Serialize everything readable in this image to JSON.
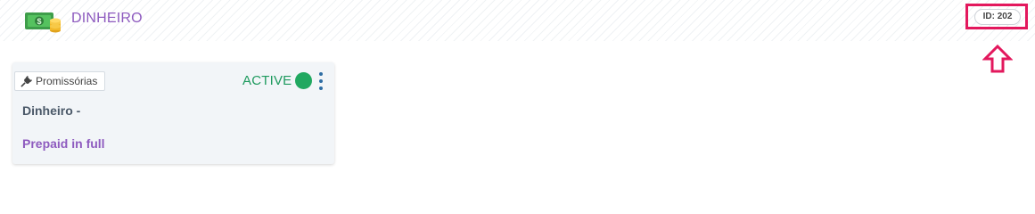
{
  "header": {
    "title": "DINHEIRO",
    "icon": "money-bill-coins-icon",
    "id_badge": "ID: 202",
    "highlight_color": "#e3185d",
    "title_color": "#8e5bbf"
  },
  "card": {
    "tag_icon": "plug-icon",
    "tag_label": "Promissórias",
    "status": "ACTIVE",
    "status_color": "#1e9a5e",
    "menu_icon": "kebab-menu-icon",
    "title": "Dinheiro -",
    "subtitle": "Prepaid in full"
  }
}
